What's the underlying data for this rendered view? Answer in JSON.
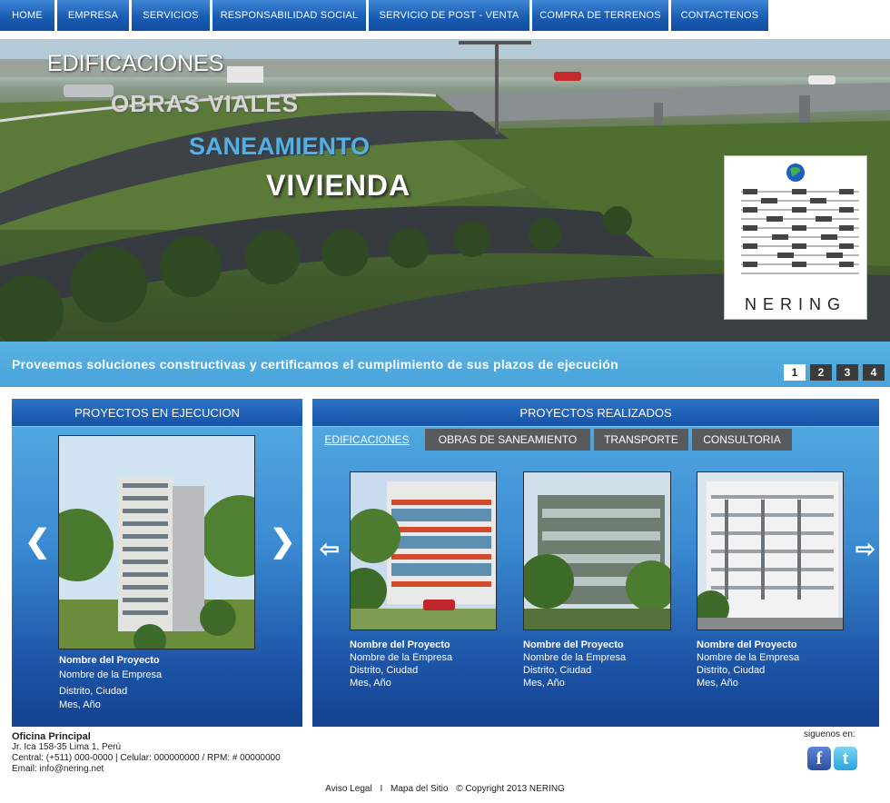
{
  "nav": [
    {
      "label": "HOME"
    },
    {
      "label": "EMPRESA"
    },
    {
      "label": "SERVICIOS"
    },
    {
      "label": "RESPONSABILIDAD SOCIAL"
    },
    {
      "label": "SERVICIO DE POST - VENTA"
    },
    {
      "label": "COMPRA DE TERRENOS"
    },
    {
      "label": "CONTACTENOS"
    }
  ],
  "hero": {
    "words": [
      "EDIFICACIONES",
      "OBRAS VIALES",
      "SANEAMIENTO",
      "VIVIENDA"
    ],
    "logo_text": "NERING",
    "slogan": "Proveemos soluciones constructivas y certificamos el cumplimiento de sus plazos de ejecución",
    "pages": [
      "1",
      "2",
      "3",
      "4"
    ],
    "active_page": "1"
  },
  "left_panel": {
    "title": "PROYECTOS EN EJECUCION",
    "project": {
      "name": "Nombre del Proyecto",
      "company": "Nombre de la Empresa",
      "location": "Distrito, Ciudad",
      "date": "Mes, Año"
    }
  },
  "right_panel": {
    "title": "PROYECTOS REALIZADOS",
    "tabs": [
      "EDIFICACIONES",
      "OBRAS DE SANEAMIENTO",
      "TRANSPORTE",
      "CONSULTORIA"
    ],
    "projects": [
      {
        "name": "Nombre del Proyecto",
        "company": "Nombre de la Empresa",
        "location": "Distrito, Ciudad",
        "date": "Mes, Año"
      },
      {
        "name": "Nombre del Proyecto",
        "company": "Nombre de la Empresa",
        "location": "Distrito, Ciudad",
        "date": "Mes, Año"
      },
      {
        "name": "Nombre del Proyecto",
        "company": "Nombre de la Empresa",
        "location": "Distrito, Ciudad",
        "date": "Mes, Año"
      }
    ]
  },
  "footer": {
    "office_head": "Oficina Principal",
    "address": "Jr. Ica 158-35 Lima 1, Perú",
    "phones": "Central: (+511) 000-0000 | Celular: 000000000 / RPM: # 00000000",
    "email": "Email: info@nering.net",
    "social_label": "siguenos en:",
    "facebook_glyph": "f",
    "twitter_glyph": "t",
    "links": [
      "Aviso Legal",
      "I",
      "Mapa del Sitio",
      "© Copyright 2013 NERING"
    ]
  },
  "colors": {
    "nav_blue": "#1a5db4",
    "band_blue": "#4aa3d9",
    "panel_top": "#55aee3",
    "panel_bottom": "#13428f",
    "tab_gray": "#585b5e"
  }
}
